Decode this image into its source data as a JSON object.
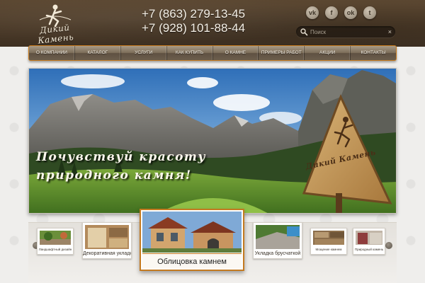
{
  "header": {
    "logo_text": "Дикий Камень",
    "phones": [
      "+7 (863) 279-13-45",
      "+7 (928) 101-88-44"
    ],
    "socials": [
      {
        "name": "vk-icon",
        "glyph": "vk"
      },
      {
        "name": "facebook-icon",
        "glyph": "f"
      },
      {
        "name": "odnoklassniki-icon",
        "glyph": "ok"
      },
      {
        "name": "twitter-icon",
        "glyph": "t"
      }
    ],
    "search": {
      "placeholder": "Поиск",
      "clear": "×"
    }
  },
  "nav": {
    "items": [
      "О компании",
      "Каталог",
      "Услуги",
      "Как купить",
      "О камне",
      "Примеры работ",
      "Акции",
      "Контакты"
    ]
  },
  "hero": {
    "slogan_line1": "Почувствуй красоту",
    "slogan_line2": "природного камня!",
    "sign_text": "Дикий Камень"
  },
  "gallery": {
    "items": [
      {
        "label": "Ландшафтный дизайн"
      },
      {
        "label": "Декоративная укладка"
      },
      {
        "label": "Облицовка камнем"
      },
      {
        "label": "Укладка брусчаткой"
      },
      {
        "label": "Мощение камнем"
      },
      {
        "label": "Природный камень"
      }
    ]
  },
  "colors": {
    "header_brown": "#4b3a28",
    "nav_border_orange": "#c77a1c",
    "featured_border": "#c47a20",
    "page_background": "#efeeec"
  }
}
